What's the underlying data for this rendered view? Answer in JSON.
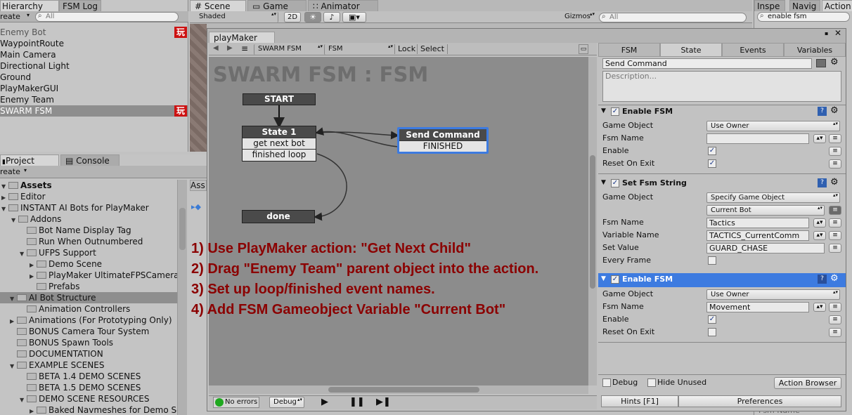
{
  "hierarchy": {
    "tabs": [
      "Hierarchy",
      "FSM Log"
    ],
    "create_label": "reate",
    "search_placeholder": "All",
    "items": [
      {
        "label": "Enemy Bot",
        "badge": "玩",
        "dim": true
      },
      {
        "label": "WaypointRoute"
      },
      {
        "label": "Main Camera"
      },
      {
        "label": "Directional Light"
      },
      {
        "label": "Ground"
      },
      {
        "label": "PlayMakerGUI"
      },
      {
        "label": "Enemy Team"
      },
      {
        "label": "SWARM FSM",
        "badge": "玩",
        "selected": true
      }
    ]
  },
  "scene": {
    "tabs": [
      "Scene",
      "Game",
      "Animator"
    ],
    "shaded_label": "Shaded",
    "mode_2d": "2D",
    "gizmos_label": "Gizmos",
    "search_placeholder": "All"
  },
  "inspector": {
    "tabs": [
      "Inspe",
      "Navig",
      "Action"
    ],
    "search_value": "enable fsm",
    "bottom_label": "Fsm Name"
  },
  "project": {
    "tabs": [
      "Project",
      "Console"
    ],
    "create_label": "reate",
    "side_tab": "Ass",
    "items": [
      {
        "label": "Assets",
        "bold": true
      },
      {
        "label": "Editor"
      },
      {
        "label": "INSTANT AI Bots for PlayMaker"
      },
      {
        "label": "Addons"
      },
      {
        "label": "Bot Name Display Tag"
      },
      {
        "label": "Run When Outnumbered"
      },
      {
        "label": "UFPS Support"
      },
      {
        "label": "Demo Scene"
      },
      {
        "label": "PlayMaker UltimateFPSCamera"
      },
      {
        "label": "Prefabs"
      },
      {
        "label": "AI Bot Structure",
        "selected": true
      },
      {
        "label": "Animation Controllers"
      },
      {
        "label": "Animations (For Prototyping Only)"
      },
      {
        "label": "BONUS Camera Tour System"
      },
      {
        "label": "BONUS Spawn Tools"
      },
      {
        "label": "DOCUMENTATION"
      },
      {
        "label": "EXAMPLE SCENES"
      },
      {
        "label": "BETA 1.4 DEMO SCENES"
      },
      {
        "label": "BETA 1.5 DEMO SCENES"
      },
      {
        "label": "DEMO SCENE RESOURCES"
      },
      {
        "label": "Baked Navmeshes for Demo Sc"
      }
    ]
  },
  "playmaker": {
    "window_tab": "playMaker",
    "fsm_owner": "SWARM FSM",
    "fsm_name": "FSM",
    "lock_label": "Lock",
    "select_label": "Select",
    "graph_title": "SWARM FSM : FSM",
    "nodes": {
      "start": "START",
      "state1": "State 1",
      "state1_events": [
        "get next bot",
        "finished loop"
      ],
      "send_command": "Send Command",
      "send_command_event": "FINISHED",
      "done": "done"
    },
    "notes": [
      "1) Use PlayMaker action: \"Get Next Child\"",
      "2) Drag \"Enemy Team\" parent object into the action.",
      "3) Set up loop/finished event names.",
      "4) Add FSM Gameobject Variable \"Current Bot\""
    ],
    "status": {
      "errors": "No errors",
      "debug": "Debug"
    },
    "right_tabs": [
      "FSM",
      "State",
      "Events",
      "Variables"
    ],
    "state_name": "Send Command",
    "description_placeholder": "Description...",
    "actions": [
      {
        "title": "Enable FSM",
        "rows": [
          {
            "label": "Game Object",
            "value": "Use Owner",
            "kind": "drop"
          },
          {
            "label": "Fsm Name",
            "value": "",
            "kind": "field"
          },
          {
            "label": "Enable",
            "checked": true,
            "kind": "check"
          },
          {
            "label": "Reset On Exit",
            "checked": true,
            "kind": "check"
          }
        ]
      },
      {
        "title": "Set Fsm String",
        "rows": [
          {
            "label": "Game Object",
            "value": "Specify Game Object",
            "kind": "drop"
          },
          {
            "label": "",
            "value": "Current Bot",
            "kind": "drop"
          },
          {
            "label": "Fsm Name",
            "value": "Tactics",
            "kind": "field"
          },
          {
            "label": "Variable Name",
            "value": "TACTICS_CurrentComm",
            "kind": "field"
          },
          {
            "label": "Set Value",
            "value": "GUARD_CHASE",
            "kind": "field"
          },
          {
            "label": "Every Frame",
            "checked": false,
            "kind": "check"
          }
        ]
      },
      {
        "title": "Enable FSM",
        "selected": true,
        "rows": [
          {
            "label": "Game Object",
            "value": "Use Owner",
            "kind": "drop"
          },
          {
            "label": "Fsm Name",
            "value": "Movement",
            "kind": "field"
          },
          {
            "label": "Enable",
            "checked": true,
            "kind": "check"
          },
          {
            "label": "Reset On Exit",
            "checked": false,
            "kind": "check"
          }
        ]
      }
    ],
    "footer": {
      "debug": "Debug",
      "hide_unused": "Hide Unused",
      "action_browser": "Action Browser",
      "hints": "Hints [F1]",
      "preferences": "Preferences"
    }
  },
  "colors": {
    "selection_blue": "#3d7be0",
    "note_red": "#8b0000",
    "badge_red": "#cc1111"
  }
}
